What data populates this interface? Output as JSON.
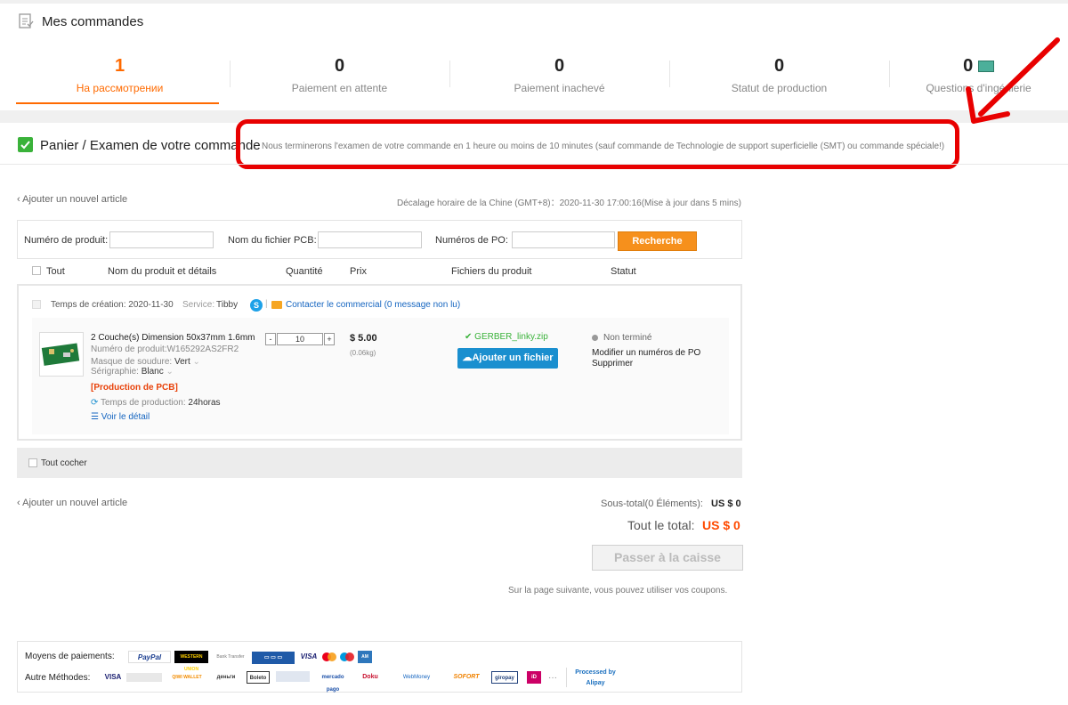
{
  "orders": {
    "title": "Mes commandes",
    "stats": [
      {
        "count": "1",
        "label": "На рассмотрении"
      },
      {
        "count": "0",
        "label": "Paiement en attente"
      },
      {
        "count": "0",
        "label": "Paiement inachevé"
      },
      {
        "count": "0",
        "label": "Statut de production"
      },
      {
        "count": "0",
        "label": "Questions d'ingénierie"
      }
    ]
  },
  "cart": {
    "title": "Panier / Examen de votre commande",
    "review_note": "Nous terminerons l'examen de votre commande en 1 heure ou moins de 10 minutes (sauf commande de Technologie de support superficielle (SMT) ou commande spéciale!)",
    "add_article": "Ajouter un nouvel article",
    "timezone": "Décalage horaire de la Chine (GMT+8)：2020-11-30 17:00:16(Mise à jour dans 5 mins)"
  },
  "search": {
    "product_number_label": "Numéro de produit:",
    "pcb_filename_label": "Nom du fichier PCB:",
    "po_numbers_label": "Numéros de PO:",
    "button": "Recherche"
  },
  "columns": {
    "all": "Tout",
    "name": "Nom du produit et détails",
    "quantity": "Quantité",
    "price": "Prix",
    "files": "Fichiers du produit",
    "status": "Statut"
  },
  "order": {
    "created": "Temps de création: 2020-11-30",
    "service_label": "Service:",
    "service_name": "Tibby",
    "contact": "Contacter le commercial (0 message non lu)",
    "item": {
      "title": "2 Couche(s) Dimension 50x37mm 1.6mm",
      "product_number": "Numéro de produit:W165292AS2FR2",
      "mask_label": "Masque de soudure:",
      "mask_value": "Vert",
      "silk_label": "Sérigraphie:",
      "silk_value": "Blanc",
      "tag": "[Production de PCB]",
      "lead_label": "Temps de production:",
      "lead_value": "24horas",
      "detail_link": "Voir le détail",
      "qty": "10",
      "price": "$ 5.00",
      "weight": "(0.06kg)",
      "file": "GERBER_linky.zip",
      "upload": "Ajouter un fichier",
      "status": "Non terminé",
      "action_po": "Modifier un numéros de PO",
      "action_delete": "Supprimer"
    }
  },
  "select_all": "Tout cocher",
  "totals": {
    "subtotal_label": "Sous-total(0 Éléments):",
    "subtotal_value": "US $ 0",
    "total_label": "Tout le total:",
    "total_value": "US $ 0",
    "checkout": "Passer à la caisse",
    "coupon_note": "Sur la page suivante, vous pouvez utiliser vos coupons."
  },
  "payments": {
    "label": "Moyens de paiements:",
    "other_label": "Autre Méthodes:",
    "logos": [
      "PayPal",
      "WESTERN UNION",
      "Bank Transfer",
      "VISA"
    ],
    "other_logos": [
      "VISA",
      "QIWI WALLET",
      "Boleto",
      "mercado pago",
      "Doku",
      "WebMoney",
      "SOFORT",
      "giropay",
      "Processed by Alipay"
    ]
  },
  "colors": {
    "accent": "#ff6a00",
    "annotation": "#e80000",
    "link": "#1565c0",
    "upload": "#1a8fcf"
  }
}
